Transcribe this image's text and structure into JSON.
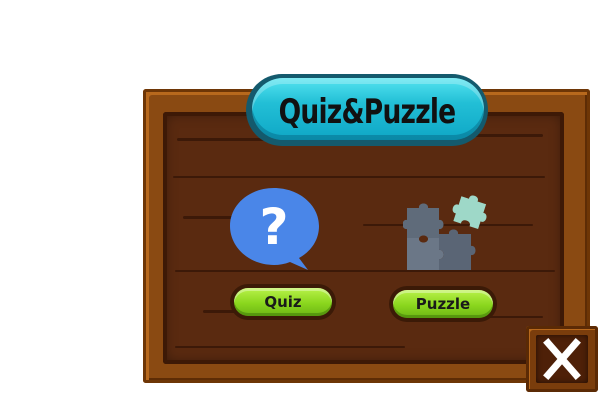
{
  "title": "Quiz&Puzzle",
  "buttons": {
    "quiz_label": "Quiz",
    "puzzle_label": "Puzzle",
    "close_icon": "close-icon"
  },
  "icons": {
    "quiz": "question-bubble-icon",
    "puzzle": "puzzle-pieces-icon"
  },
  "colors": {
    "board_wood": "#5a2a10",
    "frame_wood": "#8a4a12",
    "title_cyan": "#22bfd6",
    "button_green": "#8ad61d",
    "quiz_blue": "#4a86e8",
    "puzzle_gray": "#5f6b7a",
    "puzzle_mint": "#9ed8c8"
  }
}
